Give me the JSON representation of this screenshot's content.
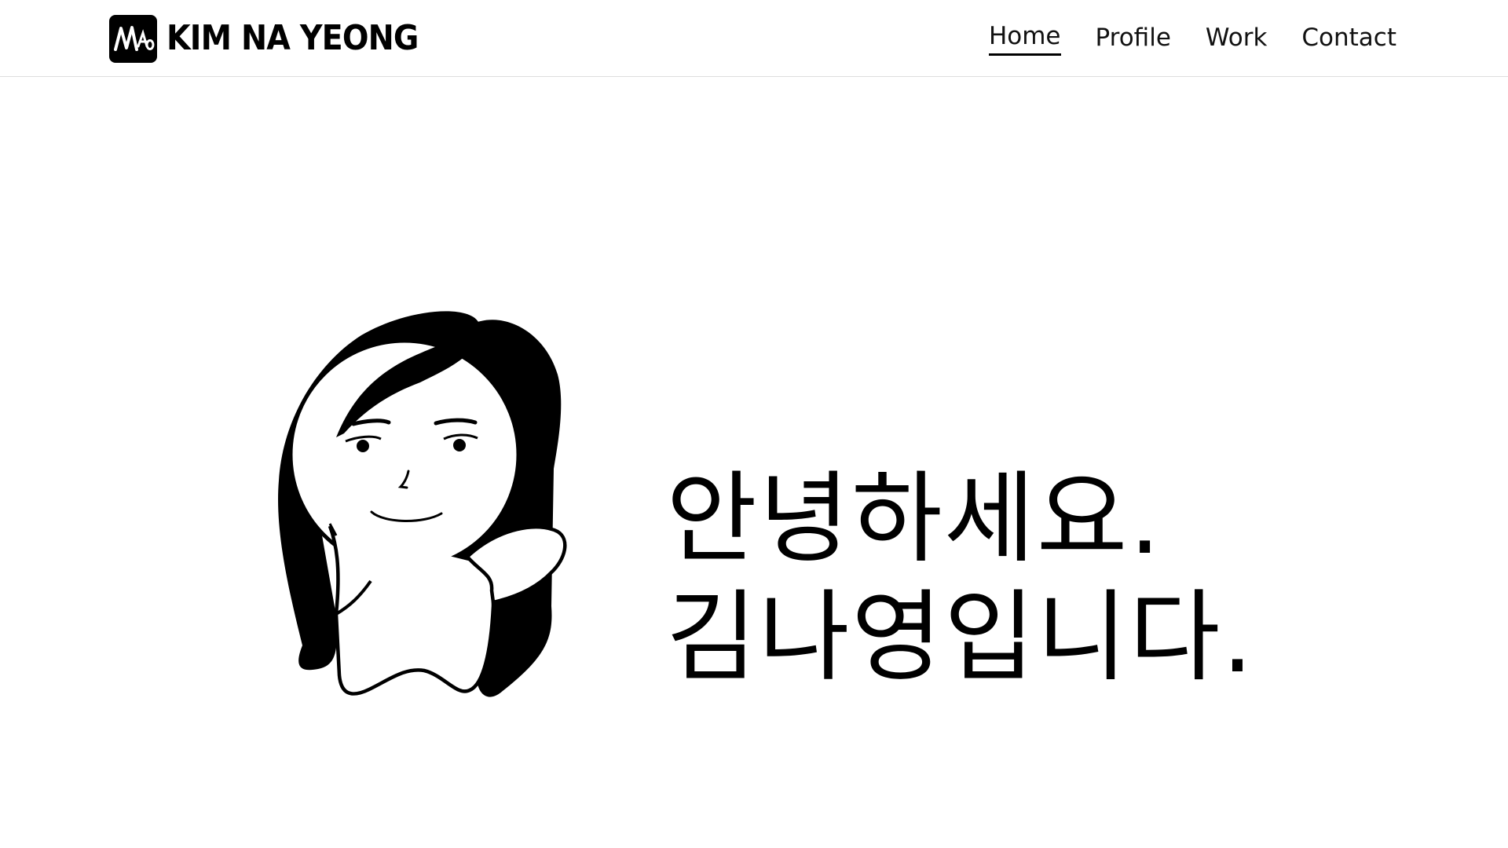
{
  "site": {
    "logo_icon": "NAY-monogram-logo",
    "brand_name": "KIM NA YEONG"
  },
  "nav": {
    "items": [
      {
        "label": "Home",
        "active": true
      },
      {
        "label": "Profile",
        "active": false
      },
      {
        "label": "Work",
        "active": false
      },
      {
        "label": "Contact",
        "active": false
      }
    ]
  },
  "hero": {
    "illustration": "girl-avatar-illustration",
    "greeting_line1": "안녕하세요.",
    "greeting_line2": "김나영입니다."
  },
  "colors": {
    "background": "#ffffff",
    "text": "#000000",
    "divider": "#dddddd"
  }
}
